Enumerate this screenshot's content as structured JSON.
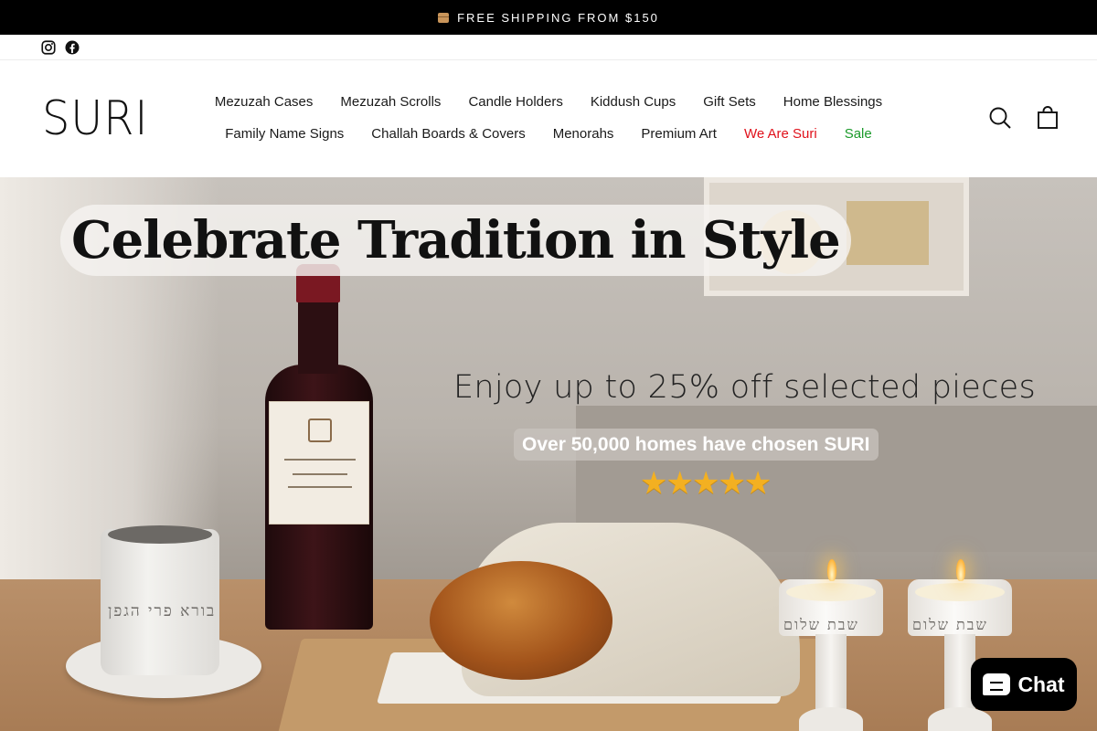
{
  "announcement": {
    "icon": "package-icon",
    "text": "FREE SHIPPING FROM $150"
  },
  "social": [
    {
      "name": "instagram-icon",
      "label": "Instagram"
    },
    {
      "name": "facebook-icon",
      "label": "Facebook"
    }
  ],
  "header": {
    "logo": "SURI",
    "nav_row1": [
      "Mezuzah Cases",
      "Mezuzah Scrolls",
      "Candle Holders",
      "Kiddush Cups",
      "Gift Sets",
      "Home Blessings"
    ],
    "nav_row2": [
      "Family Name Signs",
      "Challah Boards & Covers",
      "Menorahs",
      "Premium Art",
      "We Are Suri",
      "Sale"
    ],
    "highlight_colors": {
      "We Are Suri": "#e0111b",
      "Sale": "#1a9a2a"
    },
    "icons": [
      "search-icon",
      "cart-icon"
    ]
  },
  "hero": {
    "headline": "Celebrate Tradition in Style",
    "subheadline": "Enjoy up to 25% off selected pieces",
    "social_proof": "Over 50,000 homes have chosen SURI",
    "rating": "★★★★★",
    "cup_inscription": "בורא פרי הגפן",
    "candle_inscription": "שבת שלום"
  },
  "chat": {
    "label": "Chat"
  }
}
